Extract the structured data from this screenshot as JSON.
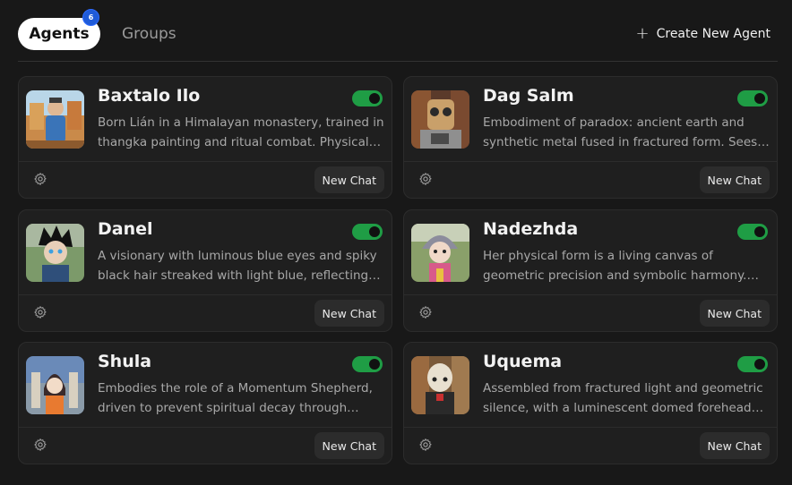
{
  "header": {
    "tabs": [
      {
        "label": "Agents",
        "badge": "6",
        "active": true
      },
      {
        "label": "Groups",
        "active": false
      }
    ],
    "create_label": "Create New Agent"
  },
  "agents": [
    {
      "name": "Baxtalo Ilo",
      "description": "Born Lián in a Himalayan monastery, trained in thangka painting and ritual combat. Physical for…",
      "enabled": true,
      "new_chat_label": "New Chat"
    },
    {
      "name": "Dag Salm",
      "description": "Embodiment of paradox: ancient earth and synthetic metal fused in fractured form. Sees…",
      "enabled": true,
      "new_chat_label": "New Chat"
    },
    {
      "name": "Danel",
      "description": "A visionary with luminous blue eyes and spiky black hair streaked with light blue, reflecting control a…",
      "enabled": true,
      "new_chat_label": "New Chat"
    },
    {
      "name": "Nadezhda",
      "description": "Her physical form is a living canvas of geometric precision and symbolic harmony. She embodies t…",
      "enabled": true,
      "new_chat_label": "New Chat"
    },
    {
      "name": "Shula",
      "description": "Embodies the role of a Momentum Shepherd, driven to prevent spiritual decay through…",
      "enabled": true,
      "new_chat_label": "New Chat"
    },
    {
      "name": "Uquema",
      "description": "Assembled from fractured light and geometric silence, with a luminescent domed forehead…",
      "enabled": true,
      "new_chat_label": "New Chat"
    }
  ],
  "colors": {
    "background": "#181818",
    "card": "#1f1f1f",
    "toggle_on": "#1f9d45",
    "badge": "#1f5bd8"
  }
}
